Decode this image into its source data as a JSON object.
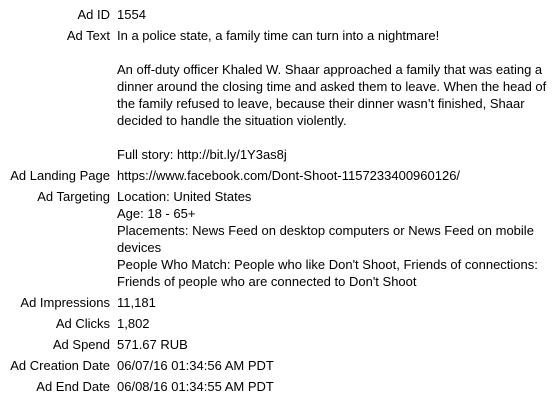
{
  "record": {
    "ad_id": {
      "label": "Ad ID",
      "value": "1554"
    },
    "ad_text": {
      "label": "Ad Text",
      "paragraphs": [
        "In a police state, a family time can turn into a nightmare!",
        "An off-duty officer Khaled W. Shaar approached a family that was eating a dinner around the closing time and asked them to leave. When the head of the family refused to leave, because their dinner wasn’t finished, Shaar decided to handle the situation violently.",
        "Full story: http://bit.ly/1Y3as8j"
      ]
    },
    "ad_landing_page": {
      "label": "Ad Landing Page",
      "value": "https://www.facebook.com/Dont-Shoot-1157233400960126/"
    },
    "ad_targeting": {
      "label": "Ad Targeting",
      "location": "Location: United States",
      "age": "Age: 18 - 65+",
      "placements": "Placements: News Feed on desktop computers or News Feed on mobile devices",
      "people_who_match": "People Who Match: People who like Don't Shoot, Friends of connections: Friends of people who are connected to Don't Shoot"
    },
    "ad_impressions": {
      "label": "Ad Impressions",
      "value": "11,181"
    },
    "ad_clicks": {
      "label": "Ad Clicks",
      "value": "1,802"
    },
    "ad_spend": {
      "label": "Ad Spend",
      "value": "571.67 RUB"
    },
    "ad_creation_date": {
      "label": "Ad Creation Date",
      "value": "06/07/16 01:34:56 AM PDT"
    },
    "ad_end_date": {
      "label": "Ad End Date",
      "value": "06/08/16 01:34:55 AM PDT"
    }
  }
}
